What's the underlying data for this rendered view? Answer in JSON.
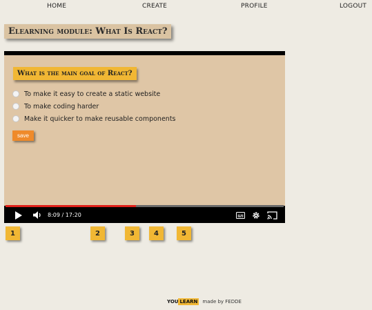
{
  "nav": {
    "home": "HOME",
    "create": "CREATE",
    "profile": "PROFILE",
    "logout": "LOGOUT"
  },
  "page_title": "Elearning module: What Is React?",
  "quiz": {
    "question": "What is the main goal of React?",
    "options": [
      "To make it easy to create a static website",
      "To make coding harder",
      "Make it quicker to make reusable components"
    ],
    "save_label": "save"
  },
  "player": {
    "time": "8:09 / 17:20",
    "progress_fraction": 0.47,
    "icons": [
      "play-icon",
      "volume-icon",
      "subtitles-icon",
      "settings-icon",
      "cast-icon"
    ]
  },
  "chapters": [
    "1",
    "2",
    "3",
    "4",
    "5"
  ],
  "footer": {
    "brand_you": "YOU",
    "brand_learn": "LEARN",
    "credit": "made by FEDDE"
  },
  "colors": {
    "accent": "#f1b734",
    "save": "#ef8a2a",
    "panel": "#dfc6a6",
    "progress": "#e0201a"
  }
}
